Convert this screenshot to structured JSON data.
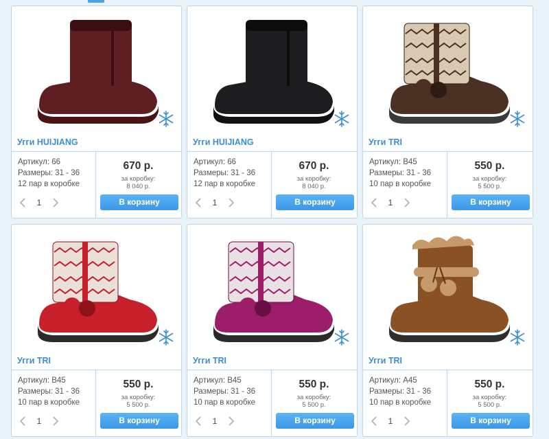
{
  "products": [
    {
      "name": "Угги HUIJIANG",
      "article": "Артикул: 66",
      "sizes": "Размеры: 31 - 36",
      "pack": "12 пар в коробке",
      "qty": "1",
      "price": "670 р.",
      "per_box_label": "за коробку:",
      "per_box": "8 040 р.",
      "button": "В корзину",
      "image_colors": {
        "main": "#5e1e22",
        "dark": "#3a0f12",
        "sole": "#4a1416"
      },
      "style": "plain"
    },
    {
      "name": "Угги HUIJIANG",
      "article": "Артикул: 66",
      "sizes": "Размеры: 31 - 36",
      "pack": "12 пар в коробке",
      "qty": "1",
      "price": "670 р.",
      "per_box_label": "за коробку:",
      "per_box": "8 040 р.",
      "button": "В корзину",
      "image_colors": {
        "main": "#1d1d1f",
        "dark": "#0c0c0d",
        "sole": "#111"
      },
      "style": "plain"
    },
    {
      "name": "Угги TRI",
      "article": "Артикул: B45",
      "sizes": "Размеры: 31 - 36",
      "pack": "10 пар в коробке",
      "qty": "1",
      "price": "550 р.",
      "per_box_label": "за коробку:",
      "per_box": "5 500 р.",
      "button": "В корзину",
      "image_colors": {
        "main": "#4b3024",
        "dark": "#2e1c14",
        "sole": "#3a3a3a",
        "knit": "#d9c9b0"
      },
      "style": "knit"
    },
    {
      "name": "Угги TRI",
      "article": "Артикул: B45",
      "sizes": "Размеры: 31 - 36",
      "pack": "10 пар в коробке",
      "qty": "1",
      "price": "550 р.",
      "per_box_label": "за коробку:",
      "per_box": "5 500 р.",
      "button": "В корзину",
      "image_colors": {
        "main": "#c8202a",
        "dark": "#8e121a",
        "sole": "#2a2a2a",
        "knit": "#e9e0d8"
      },
      "style": "knit"
    },
    {
      "name": "Угги TRI",
      "article": "Артикул: B45",
      "sizes": "Размеры: 31 - 36",
      "pack": "10 пар в коробке",
      "qty": "1",
      "price": "550 р.",
      "per_box_label": "за коробку:",
      "per_box": "5 500 р.",
      "button": "В корзину",
      "image_colors": {
        "main": "#9c1e6a",
        "dark": "#6a0f46",
        "sole": "#2a2a2a",
        "knit": "#e9e0e4"
      },
      "style": "knit"
    },
    {
      "name": "Угги TRI",
      "article": "Артикул: A45",
      "sizes": "Размеры: 31 - 36",
      "pack": "10 пар в коробке",
      "qty": "1",
      "price": "550 р.",
      "per_box_label": "за коробку:",
      "per_box": "5 500 р.",
      "button": "В корзину",
      "image_colors": {
        "main": "#8a5224",
        "dark": "#5c3515",
        "sole": "#2e2e2e",
        "fur": "#c79a6c"
      },
      "style": "fur"
    }
  ],
  "icons": {
    "snowflake": "snowflake-icon",
    "prev": "chevron-left-icon",
    "next": "chevron-right-icon"
  },
  "accent": "#3b8ddb"
}
